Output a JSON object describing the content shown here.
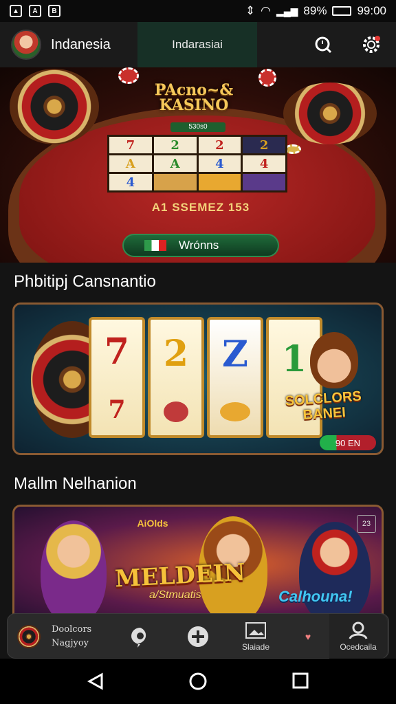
{
  "status_bar": {
    "percent": "89%",
    "time": "99:00"
  },
  "header": {
    "title": "Indanesia",
    "tab_label": "Indarasiai"
  },
  "hero": {
    "logo_line1": "PAcno~&",
    "logo_line2": "KASINO",
    "mini_label": "530s0",
    "slot_symbols": [
      "7",
      "2",
      "2",
      "2",
      "A",
      "A",
      "4",
      "4",
      "4",
      "",
      "",
      ""
    ],
    "strip_text": "A1 SSEMEZ 153",
    "win_button_label": "Wrónns"
  },
  "section1_title": "Phbitipj Cansnantio",
  "banner1": {
    "reels": [
      [
        "7",
        "7"
      ],
      [
        "2",
        ""
      ],
      [
        "Z",
        ""
      ],
      [
        "1",
        ""
      ]
    ],
    "promo_text": "SOLCLORS BANEI",
    "pill_value": "90",
    "pill_suffix": "EN"
  },
  "section2_title": "Mallm Nelhanion",
  "banner2": {
    "top_text": "AiOlds",
    "title": "MELDEIN",
    "subtitle": "a/Stmuatis",
    "right_text": "Calhouna!",
    "badge": "23"
  },
  "tabbar": {
    "tab1_line1": "Doolcors",
    "tab1_line2": "Nagjyoy",
    "tab4_label": "Slaiade",
    "tab6_label": "Ocedcaila"
  },
  "colors": {
    "accent_green": "#1f6b3a",
    "gold": "#f5c85a",
    "felt_red": "#b82826"
  }
}
